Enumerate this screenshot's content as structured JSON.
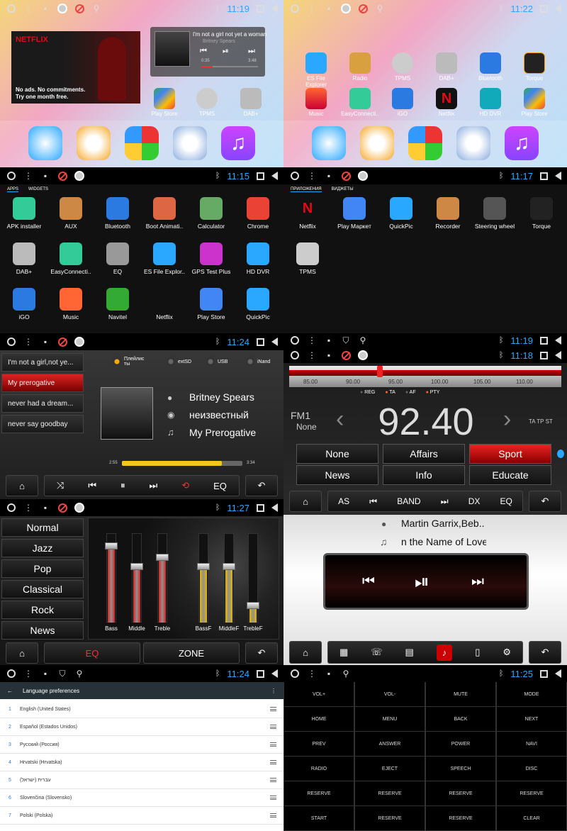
{
  "status": {
    "p1_time": "11:19",
    "p2_time": "11:22",
    "p3_time": "11:15",
    "p4_time": "11:17",
    "p5_time": "11:24",
    "p6a_time": "11:19",
    "p6b_time": "11:18",
    "p7_time": "11:27",
    "p9_time": "11:24",
    "p10_time": "11:25"
  },
  "home": {
    "netflix_logo": "NETFLIX",
    "netflix_text1": "No ads. No commitments.",
    "netflix_text2": "Try one month free.",
    "widget_title": "I'm not a girl not yet a woman",
    "widget_artist": "Britney Spears",
    "widget_time_start": "0:35",
    "widget_time_end": "3:48",
    "shortcuts": [
      "Play Store",
      "TPMS",
      "DAB+"
    ]
  },
  "favorites": [
    "ES File Explorer",
    "Radio",
    "TPMS",
    "DAB+",
    "Bluetooth",
    "Torque",
    "Music",
    "EasyConnecti..",
    "iGO",
    "Netflix",
    "HD DVR",
    "Play Store"
  ],
  "drawer_en": {
    "tabs": [
      "APPS",
      "WIDGETS"
    ],
    "apps": [
      "APK installer",
      "AUX",
      "Bluetooth",
      "Boot Animati..",
      "Calculator",
      "Chrome",
      "DAB+",
      "EasyConnecti..",
      "EQ",
      "ES File Explor..",
      "GPS Test Plus",
      "HD DVR",
      "iGO",
      "Music",
      "Navitel",
      "Netflix",
      "Play Store",
      "QuickPic"
    ]
  },
  "drawer_ru": {
    "tabs": [
      "ПРИЛОЖЕНИЯ",
      "ВИДЖЕТЫ"
    ],
    "apps": [
      "Netflix",
      "Play Маркет",
      "QuickPic",
      "Recorder",
      "Steering wheel",
      "Torque",
      "TPMS"
    ]
  },
  "music": {
    "playlist": [
      "I'm not a girl,not ye...",
      "My prerogative",
      "never had a dream...",
      "never say goodbay"
    ],
    "sources": [
      "Плейлис ты",
      "extSD",
      "USB",
      "iNand"
    ],
    "artist": "Britney Spears",
    "album": "неизвестный",
    "title": "My Prerogative",
    "time_start": "2:55",
    "time_end": "3:34",
    "progress": 0.83,
    "eq_label": "EQ"
  },
  "radio": {
    "scale": [
      "85.00",
      "90.00",
      "95.00",
      "100.00",
      "105.00",
      "110.00"
    ],
    "flags": [
      "REG",
      "TA",
      "AF",
      "PTY"
    ],
    "band": "FM1",
    "pty": "None",
    "freq": "92.40",
    "ta_tp_st": "TA TP ST",
    "pty_buttons": [
      "None",
      "Affairs",
      "Sport",
      "News",
      "Info",
      "Educate"
    ],
    "bottom": [
      "AS",
      "BAND",
      "DX",
      "EQ"
    ]
  },
  "eq": {
    "presets": [
      "Normal",
      "Jazz",
      "Pop",
      "Classical",
      "Rock",
      "News"
    ],
    "sliders": [
      "Bass",
      "Middle",
      "Treble",
      "BassF",
      "MiddleF",
      "TrebleF"
    ],
    "levels": [
      0.85,
      0.62,
      0.72,
      0.62,
      0.62,
      0.18
    ],
    "eq_tab": "EQ",
    "zone_tab": "ZONE"
  },
  "bt": {
    "artist": "Martin Garrix,Beb..",
    "title": "n the Name of Love"
  },
  "lang": {
    "title": "Language preferences",
    "items": [
      "English (United States)",
      "Español (Estados Unidos)",
      "Русский (Россия)",
      "Hrvatski (Hrvatska)",
      "עברית (ישראל)",
      "Slovenčina (Slovensko)",
      "Polski (Polska)"
    ]
  },
  "keys": [
    "VOL+",
    "VOL-",
    "MUTE",
    "MODE",
    "HOME",
    "MENU",
    "BACK",
    "NEXT",
    "PREV",
    "ANSWER",
    "POWER",
    "NAVI",
    "RADIO",
    "EJECT",
    "SPEECH",
    "DISC",
    "RESERVE",
    "RESERVE",
    "RESERVE",
    "RESERVE",
    "START",
    "RESERVE",
    "RESERVE",
    "CLEAR"
  ]
}
